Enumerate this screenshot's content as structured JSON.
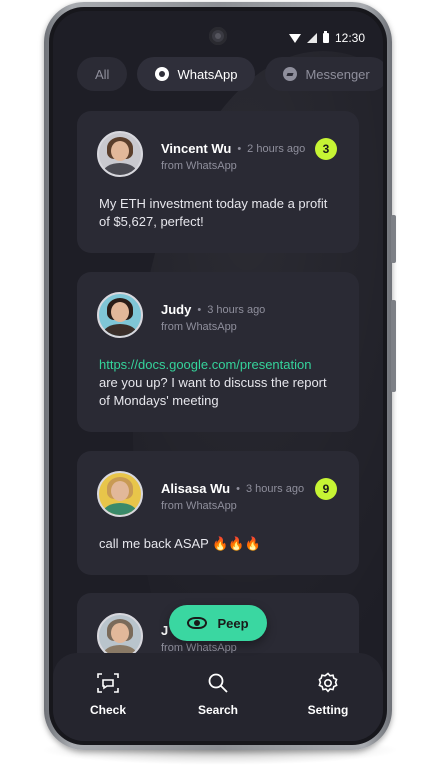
{
  "status_bar": {
    "time": "12:30"
  },
  "tabs": [
    {
      "label": "All"
    },
    {
      "label": "WhatsApp"
    },
    {
      "label": "Messenger"
    }
  ],
  "messages": [
    {
      "name": "Vincent Wu",
      "time": "2 hours ago",
      "source": "from WhatsApp",
      "badge": "3",
      "text": "My ETH investment today made a profit of $5,627, perfect!"
    },
    {
      "name": "Judy",
      "time": "3 hours ago",
      "source": "from WhatsApp",
      "link": "https://docs.google.com/presentation",
      "text": "are you up? I want to discuss the report of Mondays' meeting"
    },
    {
      "name": "Alisasa Wu",
      "time": "3 hours ago",
      "source": "from WhatsApp",
      "badge": "9",
      "text": "call me back ASAP 🔥🔥🔥"
    },
    {
      "name": "J",
      "source": "from WhatsApp"
    }
  ],
  "peep_button": {
    "label": "Peep"
  },
  "bottom_nav": [
    {
      "label": "Check",
      "icon": "scan-chat-icon"
    },
    {
      "label": "Search",
      "icon": "search-icon"
    },
    {
      "label": "Setting",
      "icon": "gear-icon"
    }
  ],
  "colors": {
    "background": "#1e1e26",
    "card": "#2a2a34",
    "badge": "#c6f434",
    "accent_green": "#3ad7a1",
    "link": "#35d39b"
  }
}
